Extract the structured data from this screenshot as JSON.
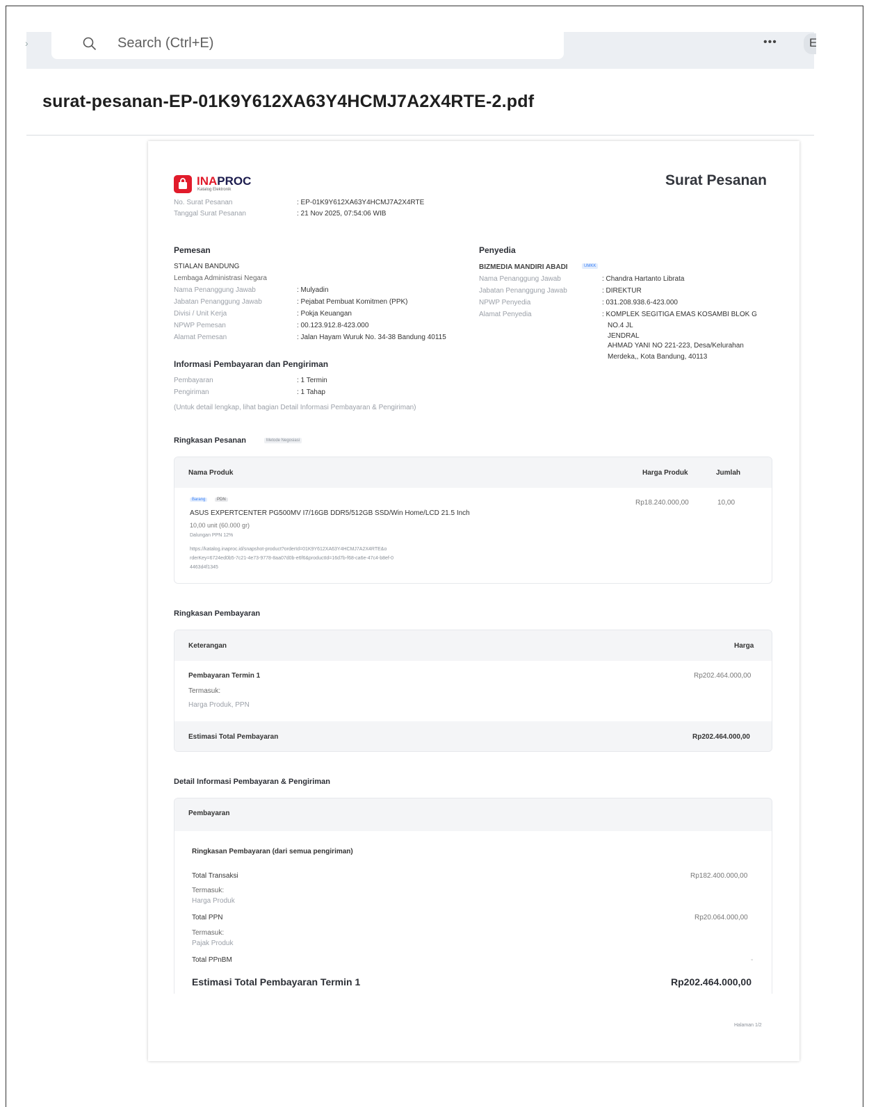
{
  "browser": {
    "search_placeholder": "Search (Ctrl+E)",
    "more_label": "•••",
    "edge_letter": "E"
  },
  "file_name": "surat-pesanan-EP-01K9Y612XA63Y4HCMJ7A2X4RTE-2.pdf",
  "doc": {
    "logo_main_a": "INA",
    "logo_main_b": "PROC",
    "logo_sub": "Katalog Elektronik",
    "title": "Surat Pesanan",
    "no_label": "No. Surat Pesanan",
    "no_value": ": EP-01K9Y612XA63Y4HCMJ7A2X4RTE",
    "date_label": "Tanggal Surat Pesanan",
    "date_value": ": 21 Nov 2025, 07:54:06 WIB",
    "pemesan": {
      "heading": "Pemesan",
      "org": "STIALAN BANDUNG",
      "org_sub": "Lembaga Administrasi Negara",
      "rows": [
        {
          "label": "Nama Penanggung Jawab",
          "value": ": Mulyadin"
        },
        {
          "label": "Jabatan Penanggung Jawab",
          "value": ": Pejabat Pembuat Komitmen (PPK)"
        },
        {
          "label": "Divisi / Unit Kerja",
          "value": ": Pokja Keuangan"
        },
        {
          "label": "NPWP Pemesan",
          "value": ": 00.123.912.8-423.000"
        },
        {
          "label": "Alamat Pemesan",
          "value": ": Jalan Hayam Wuruk No. 34-38 Bandung 40115"
        }
      ]
    },
    "penyedia": {
      "heading": "Penyedia",
      "org": "BIZMEDIA MANDIRI ABADI",
      "badge": "UMKK",
      "rows": [
        {
          "label": "Nama Penanggung Jawab",
          "value": ": Chandra Hartanto Librata"
        },
        {
          "label": "Jabatan Penanggung Jawab",
          "value": ": DIREKTUR"
        },
        {
          "label": "NPWP Penyedia",
          "value": ": 031.208.938.6-423.000"
        },
        {
          "label": "Alamat Penyedia",
          "value": ": KOMPLEK SEGITIGA EMAS KOSAMBI BLOK G"
        }
      ],
      "address_lines": [
        "NO.4 JL",
        "JENDRAL",
        "AHMAD YANI NO 221-223, Desa/Kelurahan",
        "Merdeka,, Kota Bandung, 40113"
      ]
    },
    "info": {
      "heading": "Informasi Pembayaran dan Pengiriman",
      "rows": [
        {
          "label": "Pembayaran",
          "value": ": 1 Termin"
        },
        {
          "label": "Pengiriman",
          "value": ": 1 Tahap"
        }
      ],
      "note": "(Untuk detail lengkap, lihat bagian Detail Informasi Pembayaran & Pengiriman)"
    },
    "ringkasan_pesanan": {
      "heading": "Ringkasan Pesanan",
      "tag": "Metode Negosiasi",
      "col_name": "Nama Produk",
      "col_price": "Harga Produk",
      "col_qty": "Jumlah",
      "product": {
        "tag1": "Barang",
        "tag2": "PDN",
        "name": "ASUS EXPERTCENTER PG500MV I7/16GB DDR5/512GB SSD/Win Home/LCD 21.5 Inch",
        "qty_line": "10,00 unit (60.000 gr)",
        "tkdn": "Dalungan PPN 12%",
        "url_1": "https://katalog.inaproc.id/snapshot-product?orderId=01K9Y612XA63Y4HCMJ7A2X4RTE&o",
        "url_2": "rderKey=6724ed0b5-7c21-4e73-9778-8aa07d0b-e6f6&productId=16d7b-f68-ca6e-47c4-b8ef-0",
        "url_3": "4463d4f1345",
        "price": "Rp18.240.000,00",
        "qty": "10,00"
      }
    },
    "ringkasan_pembayaran": {
      "heading": "Ringkasan Pembayaran",
      "col_desc": "Keterangan",
      "col_price": "Harga",
      "termin_label": "Pembayaran Termin 1",
      "termin_value": "Rp202.464.000,00",
      "includes_label": "Termasuk:",
      "includes_items": "Harga Produk, PPN",
      "total_label": "Estimasi Total Pembayaran",
      "total_value": "Rp202.464.000,00"
    },
    "detail": {
      "heading": "Detail Informasi Pembayaran & Pengiriman",
      "card_head": "Pembayaran",
      "sub_heading": "Ringkasan Pembayaran (dari semua pengiriman)",
      "total_transaksi_label": "Total Transaksi",
      "total_transaksi_value": "Rp182.400.000,00",
      "termasuk_1": "Termasuk:",
      "harga_produk": "Harga Produk",
      "total_ppn_label": "Total PPN",
      "total_ppn_value": "Rp20.064.000,00",
      "termasuk_2": "Termasuk:",
      "pajak_produk": "Pajak Produk",
      "total_ppnbm_label": "Total PPnBM",
      "total_ppnbm_value": "-",
      "estimasi_label": "Estimasi Total Pembayaran Termin 1",
      "estimasi_value": "Rp202.464.000,00"
    },
    "page_num": "Halaman 1/2"
  },
  "colors": {
    "brand_red": "#e11b2b",
    "brand_navy": "#1b1b4d",
    "card_header_bg": "#f4f5f7"
  }
}
